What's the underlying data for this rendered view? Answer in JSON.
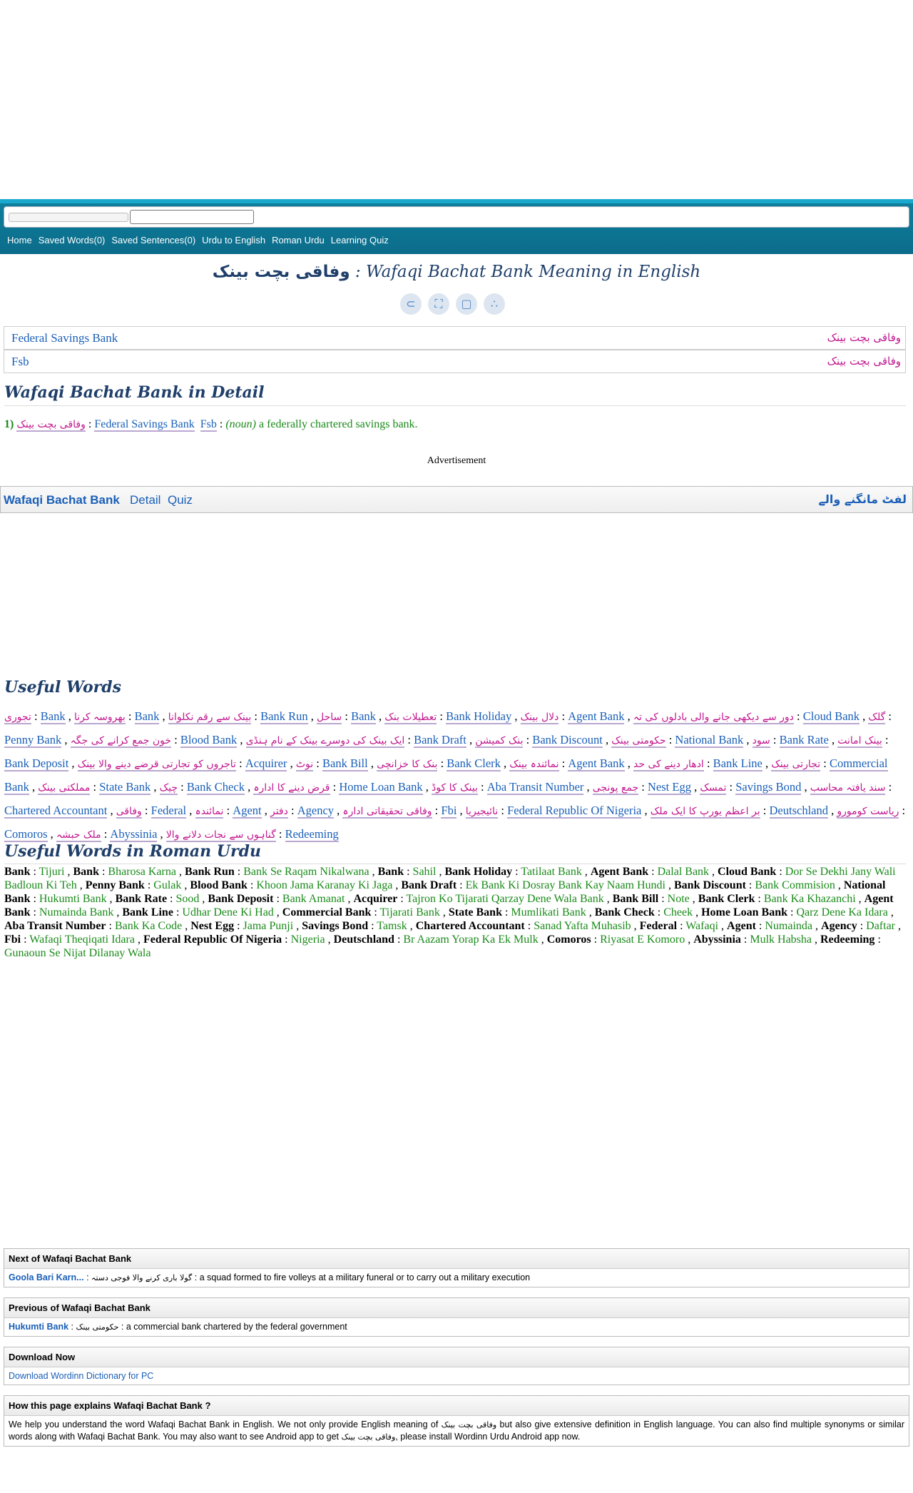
{
  "nav": [
    "Home",
    "Saved Words(0)",
    "Saved Sentences(0)",
    "Urdu to English",
    "Roman Urdu",
    "Learning Quiz"
  ],
  "title": {
    "urdu": "وفاقی بچت بینک",
    "sep": " : ",
    "english": "Wafaqi Bachat Bank Meaning in English"
  },
  "icons": [
    "copy-icon",
    "fullscreen-icon",
    "square-icon",
    "share-icon"
  ],
  "meanings": [
    {
      "english": "Federal Savings Bank",
      "urdu": "وفاقی بچت بینک"
    },
    {
      "english": "Fsb",
      "urdu": "وفاقی بچت بینک"
    }
  ],
  "detail": {
    "heading": "Wafaqi Bachat Bank in Detail",
    "num": "1)",
    "urdu": "وفاقی بچت بینک",
    "sep": " : ",
    "w1": "Federal Savings Bank",
    "w2": "Fsb",
    "pos": "(noun)",
    "definition": " a federally chartered savings bank."
  },
  "advertisement": "Advertisement",
  "bar2": {
    "word": "Wafaqi Bachat Bank",
    "detail": "Detail",
    "quiz": "Quiz",
    "urdu": "لفٹ مانگنے والے"
  },
  "useful_heading": "Useful Words",
  "useful_words": [
    [
      "دور سے دیکھی جانے والی بادلوں کی تہ",
      "Cloud Bank",
      "گلک",
      "Penny Bank",
      "خون جمع کرانے کی جگہ",
      "Blood Bank",
      "ایک بینک کی دوسرے بینک کے نام ہنڈی",
      "Bank Draft",
      "بنک کمیشن",
      "Bank Discount",
      "حکومتی بینک"
    ],
    [],
    []
  ],
  "useful_text": [
    {
      "t": "ur",
      "v": "تجوری"
    },
    {
      "t": "s",
      "v": " : "
    },
    {
      "t": "en",
      "v": "Bank"
    },
    {
      "t": "s",
      "v": " , "
    },
    {
      "t": "ur",
      "v": "بھروسہ کرنا"
    },
    {
      "t": "s",
      "v": " : "
    },
    {
      "t": "en",
      "v": "Bank"
    },
    {
      "t": "s",
      "v": " , "
    },
    {
      "t": "ur",
      "v": "بینک سے رقم نکلوانا"
    },
    {
      "t": "s",
      "v": " : "
    },
    {
      "t": "en",
      "v": "Bank Run"
    },
    {
      "t": "s",
      "v": " , "
    },
    {
      "t": "ur",
      "v": "ساحل"
    },
    {
      "t": "s",
      "v": " : "
    },
    {
      "t": "en",
      "v": "Bank"
    },
    {
      "t": "s",
      "v": " , "
    },
    {
      "t": "ur",
      "v": "تعطیلات بنک"
    },
    {
      "t": "s",
      "v": " : "
    },
    {
      "t": "en",
      "v": "Bank Holiday"
    },
    {
      "t": "s",
      "v": " , "
    },
    {
      "t": "ur",
      "v": "دلال بینک"
    },
    {
      "t": "s",
      "v": " : "
    },
    {
      "t": "en",
      "v": "Agent Bank"
    },
    {
      "t": "s",
      "v": " , "
    },
    {
      "t": "ur",
      "v": "دور سے دیکھی جانے والی بادلوں کی تہ"
    },
    {
      "t": "s",
      "v": " : "
    },
    {
      "t": "en",
      "v": "Cloud Bank"
    },
    {
      "t": "s",
      "v": " , "
    },
    {
      "t": "ur",
      "v": "گلک"
    },
    {
      "t": "s",
      "v": " : "
    },
    {
      "t": "en",
      "v": "Penny Bank"
    },
    {
      "t": "s",
      "v": " , "
    },
    {
      "t": "ur",
      "v": "خون جمع کرانے کی جگہ"
    },
    {
      "t": "s",
      "v": " : "
    },
    {
      "t": "en",
      "v": "Blood Bank"
    },
    {
      "t": "s",
      "v": " , "
    },
    {
      "t": "ur",
      "v": "ایک بینک کی دوسرے بینک کے نام ہنڈی"
    },
    {
      "t": "s",
      "v": " : "
    },
    {
      "t": "en",
      "v": "Bank Draft"
    },
    {
      "t": "s",
      "v": " , "
    },
    {
      "t": "ur",
      "v": "بنک کمیشن"
    },
    {
      "t": "s",
      "v": " : "
    },
    {
      "t": "en",
      "v": "Bank Discount"
    },
    {
      "t": "s",
      "v": " , "
    },
    {
      "t": "ur",
      "v": "حکومتی بینک"
    },
    {
      "t": "s",
      "v": " : "
    },
    {
      "t": "en",
      "v": "National Bank"
    },
    {
      "t": "s",
      "v": " , "
    },
    {
      "t": "ur",
      "v": "سود"
    },
    {
      "t": "s",
      "v": " : "
    },
    {
      "t": "en",
      "v": "Bank Rate"
    },
    {
      "t": "s",
      "v": " , "
    },
    {
      "t": "ur",
      "v": "بینک امانت"
    },
    {
      "t": "s",
      "v": " : "
    },
    {
      "t": "en",
      "v": "Bank Deposit"
    },
    {
      "t": "s",
      "v": " , "
    },
    {
      "t": "ur",
      "v": "تاجروں کو تجارتی قرضے دینے والا بینک"
    },
    {
      "t": "s",
      "v": " : "
    },
    {
      "t": "en",
      "v": "Acquirer"
    },
    {
      "t": "s",
      "v": " , "
    },
    {
      "t": "ur",
      "v": "نوٹ"
    },
    {
      "t": "s",
      "v": " : "
    },
    {
      "t": "en",
      "v": "Bank Bill"
    },
    {
      "t": "s",
      "v": " , "
    },
    {
      "t": "ur",
      "v": "بنک کا خزانچی"
    },
    {
      "t": "s",
      "v": " : "
    },
    {
      "t": "en",
      "v": "Bank Clerk"
    },
    {
      "t": "s",
      "v": " , "
    },
    {
      "t": "ur",
      "v": "نمائندہ بینک"
    },
    {
      "t": "s",
      "v": " : "
    },
    {
      "t": "en",
      "v": "Agent Bank"
    },
    {
      "t": "s",
      "v": " , "
    },
    {
      "t": "ur",
      "v": "ادھار دینے کی حد"
    },
    {
      "t": "s",
      "v": " : "
    },
    {
      "t": "en",
      "v": "Bank Line"
    },
    {
      "t": "s",
      "v": " , "
    },
    {
      "t": "ur",
      "v": "تجارتی بینک"
    },
    {
      "t": "s",
      "v": " : "
    },
    {
      "t": "en",
      "v": "Commercial Bank"
    },
    {
      "t": "s",
      "v": " , "
    },
    {
      "t": "ur",
      "v": "مملکتی بینک"
    },
    {
      "t": "s",
      "v": " : "
    },
    {
      "t": "en",
      "v": "State Bank"
    },
    {
      "t": "s",
      "v": " , "
    },
    {
      "t": "ur",
      "v": "چیک"
    },
    {
      "t": "s",
      "v": " : "
    },
    {
      "t": "en",
      "v": "Bank Check"
    },
    {
      "t": "s",
      "v": " , "
    },
    {
      "t": "ur",
      "v": "قرض دینے کا ادارہ"
    },
    {
      "t": "s",
      "v": " : "
    },
    {
      "t": "en",
      "v": "Home Loan Bank"
    },
    {
      "t": "s",
      "v": " , "
    },
    {
      "t": "ur",
      "v": "بینک کا کوڈ"
    },
    {
      "t": "s",
      "v": " : "
    },
    {
      "t": "en",
      "v": "Aba Transit Number"
    },
    {
      "t": "s",
      "v": " , "
    },
    {
      "t": "ur",
      "v": "جمع پونجی"
    },
    {
      "t": "s",
      "v": " : "
    },
    {
      "t": "en",
      "v": "Nest Egg"
    },
    {
      "t": "s",
      "v": " , "
    },
    {
      "t": "ur",
      "v": "تمسک"
    },
    {
      "t": "s",
      "v": " : "
    },
    {
      "t": "en",
      "v": "Savings Bond"
    },
    {
      "t": "s",
      "v": " , "
    },
    {
      "t": "ur",
      "v": "سند یافتہ محاسب"
    },
    {
      "t": "s",
      "v": " : "
    },
    {
      "t": "en",
      "v": "Chartered Accountant"
    },
    {
      "t": "s",
      "v": " , "
    },
    {
      "t": "ur",
      "v": "وفاقی"
    },
    {
      "t": "s",
      "v": " : "
    },
    {
      "t": "en",
      "v": "Federal"
    },
    {
      "t": "s",
      "v": " , "
    },
    {
      "t": "ur",
      "v": "نمائندہ"
    },
    {
      "t": "s",
      "v": " : "
    },
    {
      "t": "en",
      "v": "Agent"
    },
    {
      "t": "s",
      "v": " , "
    },
    {
      "t": "ur",
      "v": "دفتر"
    },
    {
      "t": "s",
      "v": " : "
    },
    {
      "t": "en",
      "v": "Agency"
    },
    {
      "t": "s",
      "v": " , "
    },
    {
      "t": "ur",
      "v": "وفاقی تحقیقاتی ادارہ"
    },
    {
      "t": "s",
      "v": " : "
    },
    {
      "t": "en",
      "v": "Fbi"
    },
    {
      "t": "s",
      "v": " , "
    },
    {
      "t": "ur",
      "v": "نائیجیریا"
    },
    {
      "t": "s",
      "v": " : "
    },
    {
      "t": "en",
      "v": "Federal Republic Of Nigeria"
    },
    {
      "t": "s",
      "v": " , "
    },
    {
      "t": "ur",
      "v": "بر اعظم یورپ کا ایک ملک"
    },
    {
      "t": "s",
      "v": " : "
    },
    {
      "t": "en",
      "v": "Deutschland"
    },
    {
      "t": "s",
      "v": " , "
    },
    {
      "t": "ur",
      "v": "ریاست کومورو"
    },
    {
      "t": "s",
      "v": " : "
    },
    {
      "t": "en",
      "v": "Comoros"
    },
    {
      "t": "s",
      "v": " , "
    },
    {
      "t": "ur",
      "v": "ملک حبشہ"
    },
    {
      "t": "s",
      "v": " : "
    },
    {
      "t": "en",
      "v": "Abyssinia"
    },
    {
      "t": "s",
      "v": " , "
    },
    {
      "t": "ur",
      "v": "گناہوں سے نجات دلانے والا"
    },
    {
      "t": "s",
      "v": " : "
    },
    {
      "t": "en",
      "v": "Redeeming"
    }
  ],
  "roman_heading": "Useful Words in Roman Urdu",
  "roman": [
    [
      "Bank",
      "Tijuri"
    ],
    [
      "Bank",
      "Bharosa Karna"
    ],
    [
      "Bank Run",
      "Bank Se Raqam Nikalwana"
    ],
    [
      "Bank",
      "Sahil"
    ],
    [
      "Bank Holiday",
      "Tatilaat Bank"
    ],
    [
      "Agent Bank",
      "Dalal Bank"
    ],
    [
      "Cloud Bank",
      "Dor Se Dekhi Jany Wali Badloun Ki Teh"
    ],
    [
      "Penny Bank",
      "Gulak"
    ],
    [
      "Blood Bank",
      "Khoon Jama Karanay Ki Jaga"
    ],
    [
      "Bank Draft",
      "Ek Bank Ki Dosray Bank Kay Naam Hundi"
    ],
    [
      "Bank Discount",
      "Bank Commision"
    ],
    [
      "National Bank",
      "Hukumti Bank"
    ],
    [
      "Bank Rate",
      "Sood"
    ],
    [
      "Bank Deposit",
      "Bank Amanat"
    ],
    [
      "Acquirer",
      "Tajron Ko Tijarati Qarzay Dene Wala Bank"
    ],
    [
      "Bank Bill",
      "Note"
    ],
    [
      "Bank Clerk",
      "Bank Ka Khazanchi"
    ],
    [
      "Agent Bank",
      "Numainda Bank"
    ],
    [
      "Bank Line",
      "Udhar Dene Ki Had"
    ],
    [
      "Commercial Bank",
      "Tijarati Bank"
    ],
    [
      "State Bank",
      "Mumlikati Bank"
    ],
    [
      "Bank Check",
      "Cheek"
    ],
    [
      "Home Loan Bank",
      "Qarz Dene Ka Idara"
    ],
    [
      "Aba Transit Number",
      "Bank Ka Code"
    ],
    [
      "Nest Egg",
      "Jama Punji"
    ],
    [
      "Savings Bond",
      "Tamsk"
    ],
    [
      "Chartered Accountant",
      "Sanad Yafta Muhasib"
    ],
    [
      "Federal",
      "Wafaqi"
    ],
    [
      "Agent",
      "Numainda"
    ],
    [
      "Agency",
      "Daftar"
    ],
    [
      "Fbi",
      "Wafaqi Theqiqati Idara"
    ],
    [
      "Federal Republic Of Nigeria",
      "Nigeria"
    ],
    [
      "Deutschland",
      "Br Aazam Yorap Ka Ek Mulk"
    ],
    [
      "Comoros",
      "Riyasat E Komoro"
    ],
    [
      "Abyssinia",
      "Mulk Habsha"
    ],
    [
      "Redeeming",
      "Gunaoun Se Nijat Dilanay Wala"
    ]
  ],
  "next": {
    "heading": "Next of Wafaqi Bachat Bank",
    "word": "Goola Bari Karn...",
    "urdu": "گولا باری کرنے والا فوجی دستہ",
    "definition": "a squad formed to fire volleys at a military funeral or to carry out a military execution"
  },
  "previous": {
    "heading": "Previous of Wafaqi Bachat Bank",
    "word": "Hukumti Bank",
    "urdu": "حکومتی بینک",
    "definition": "a commercial bank chartered by the federal government"
  },
  "download": {
    "heading": "Download Now",
    "link": "Download Wordinn Dictionary for PC"
  },
  "explain": {
    "heading": "How this page explains Wafaqi Bachat Bank ?",
    "p1": "We help you understand the word Wafaqi Bachat Bank in English. We not only provide English meaning of ",
    "urdu": "وفاقی بچت بینک",
    "p2": " but also give extensive definition in English language. You can also find multiple synonyms or similar words along with Wafaqi Bachat Bank. You may also want to see Android app to get ",
    "urdu2": "وفاقی بچت بینک",
    "p3": ", please install Wordinn Urdu Android app now."
  }
}
